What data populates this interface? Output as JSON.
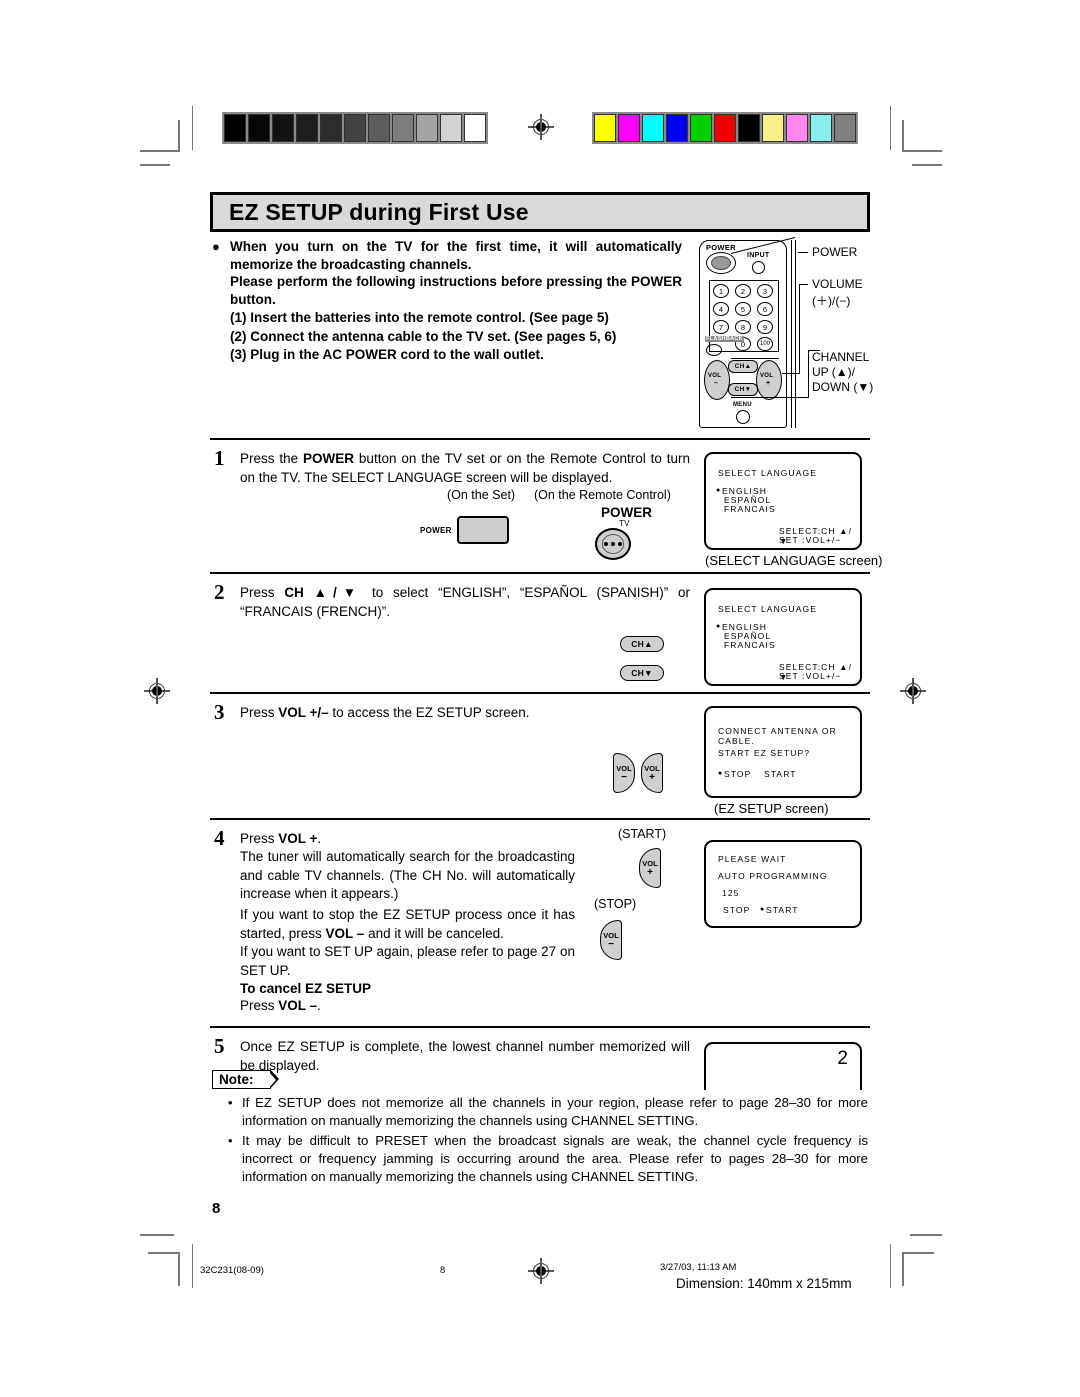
{
  "document": {
    "title": "EZ SETUP during First Use",
    "page_number": "8"
  },
  "intro": {
    "bullet_glyph": "●",
    "line1": "When you turn on the TV for the first time, it will automatically memorize the broadcasting channels.",
    "line2": "Please perform the following instructions before pressing the POWER button.",
    "item1": "(1) Insert the batteries into the remote control. (See page 5)",
    "item2": "(2) Connect the antenna cable to the TV set.  (See pages 5, 6)",
    "item3": "(3) Plug in the AC POWER cord to the wall outlet."
  },
  "remote_diagram": {
    "label_power": "POWER",
    "label_input": "INPUT",
    "label_flashback": "FLASHBACK",
    "label_menu": "MENU",
    "label_ch_up": "CH▲",
    "label_ch_down": "CH▼",
    "label_vol_minus": "VOL",
    "label_vol_plus": "VOL",
    "keys": [
      "1",
      "2",
      "3",
      "4",
      "5",
      "6",
      "7",
      "8",
      "9",
      "0",
      "100"
    ],
    "callouts": {
      "power": "POWER",
      "volume_line1": "VOLUME",
      "volume_line2": "(＋)/(−)",
      "channel_line1": "CHANNEL",
      "channel_line2": "UP (▲)/",
      "channel_line3": "DOWN (▼)"
    }
  },
  "steps": [
    {
      "num": "1",
      "text_parts": [
        {
          "t": "Press the ",
          "b": false
        },
        {
          "t": "POWER",
          "b": true
        },
        {
          "t": " button on the TV set or on the Remote Control to turn on the TV. The SELECT LANGUAGE screen will be displayed.",
          "b": false
        }
      ],
      "full_text": "Press the POWER button on the TV set or on the Remote Control to turn on the TV. The SELECT LANGUAGE screen will be displayed.",
      "caption_on_set": "(On the Set)",
      "caption_on_remote": "(On the Remote Control)",
      "set_button_label": "POWER",
      "remote_button_label_1": "POWER",
      "remote_button_label_2": "TV",
      "screen_caption": "(SELECT LANGUAGE screen)"
    },
    {
      "num": "2",
      "full_text": "Press CH ▲/▼ to select “ENGLISH”, “ESPAÑOL (SPANISH)” or “FRANCAIS (FRENCH)”.",
      "btn_up": "CH▲",
      "btn_down": "CH▼"
    },
    {
      "num": "3",
      "full_text": "Press VOL +/− to access the EZ SETUP screen.",
      "btn_minus_l1": "VOL",
      "btn_minus_l2": "−",
      "btn_plus_l1": "VOL",
      "btn_plus_l2": "+",
      "screen_caption": "(EZ SETUP screen)"
    },
    {
      "num": "4",
      "line1": "Press VOL +.",
      "line2": "The tuner will automatically search for the broadcasting and cable TV channels. (The CH No. will automatically increase when it appears.)",
      "line3": "If you want to stop the EZ SETUP process once it has started, press VOL − and it will be canceled.",
      "line4": "If you want to SET UP again, please refer to page 27 on SET UP.",
      "heading": "To cancel EZ SETUP",
      "line5": "Press VOL −.",
      "label_start": "(START)",
      "label_stop": "(STOP)",
      "btn_plus_l1": "VOL",
      "btn_plus_l2": "+",
      "btn_minus_l1": "VOL",
      "btn_minus_l2": "−"
    },
    {
      "num": "5",
      "full_text": "Once EZ SETUP is complete, the lowest channel number memorized will be displayed.",
      "screen_value": "2"
    }
  ],
  "osd_screens": {
    "select_language": {
      "title": "SELECT LANGUAGE",
      "marker": "●",
      "options": [
        "ENGLISH",
        "ESPAÑOL",
        "FRANCAIS"
      ],
      "hint1": "SELECT:CH ▲/▼",
      "hint2": "SET   :VOL+/−"
    },
    "ez_setup": {
      "line1": "CONNECT ANTENNA OR CABLE.",
      "line2": "START EZ SETUP?",
      "marker": "●",
      "opt_stop": "STOP",
      "opt_start": "START"
    },
    "auto_programming": {
      "line1": "PLEASE WAIT",
      "line2": "AUTO PROGRAMMING",
      "channel": "125",
      "opt_stop": "STOP",
      "marker": "●",
      "opt_start": "START"
    }
  },
  "note": {
    "badge": "Note:",
    "bullet_glyph": "•",
    "items": [
      "If EZ SETUP does not memorize all the channels in your region, please refer to page 28–30 for more information on manually memorizing the channels using CHANNEL SETTING.",
      "It may be difficult to PRESET when the broadcast signals are weak, the channel cycle frequency is incorrect or frequency jamming is occurring around the area. Please refer to pages 28–30 for more information on manually memorizing the channels using CHANNEL SETTING."
    ]
  },
  "footer": {
    "job_code": "32C231(08-09)",
    "page": "8",
    "timestamp": "3/27/03, 11:13 AM",
    "dimension": "Dimension: 140mm x 215mm"
  },
  "calibration": {
    "gray_wedge": [
      "#000000",
      "#070707",
      "#121212",
      "#1e1e1e",
      "#2c2c2c",
      "#434343",
      "#5d5d5d",
      "#7e7e7e",
      "#a3a3a3",
      "#d2d2d2",
      "#ffffff"
    ],
    "color_bars": [
      "#ffff00",
      "#ff00ff",
      "#00ffff",
      "#0000ee",
      "#00cc00",
      "#ee0000",
      "#000000",
      "#faf08a",
      "#ff88ee",
      "#88eeee",
      "#808080"
    ]
  }
}
